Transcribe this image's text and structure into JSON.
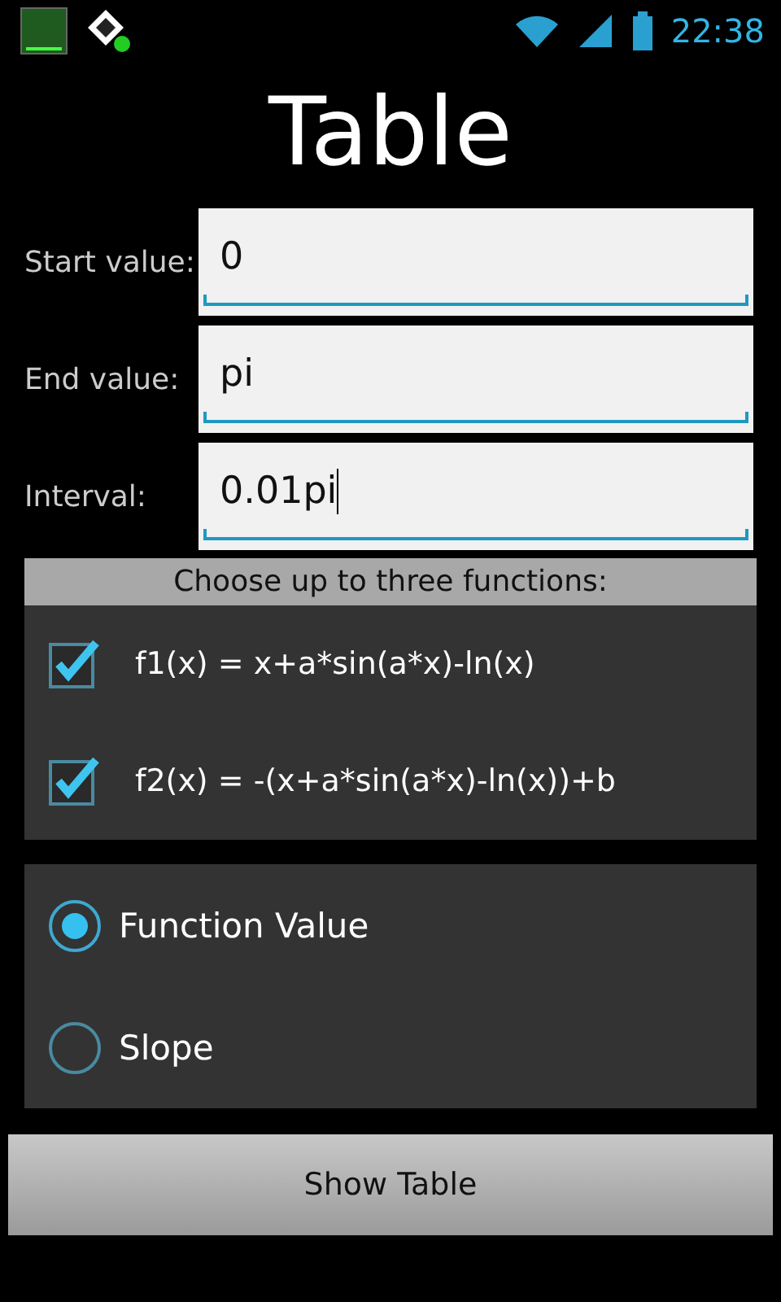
{
  "status_bar": {
    "time": "22:38"
  },
  "title": "Table",
  "fields": [
    {
      "label": "Start value:",
      "value": "0",
      "focused": false
    },
    {
      "label": "End value:",
      "value": "pi",
      "focused": false
    },
    {
      "label": "Interval:",
      "value": "0.01pi",
      "focused": true
    }
  ],
  "functions": {
    "header": "Choose up to three functions:",
    "items": [
      {
        "label": "f1(x) = x+a*sin(a*x)-ln(x)",
        "checked": true
      },
      {
        "label": "f2(x) = -(x+a*sin(a*x)-ln(x))+b",
        "checked": true
      }
    ]
  },
  "modes": [
    {
      "label": "Function Value",
      "selected": true
    },
    {
      "label": "Slope",
      "selected": false
    }
  ],
  "button": "Show Table"
}
